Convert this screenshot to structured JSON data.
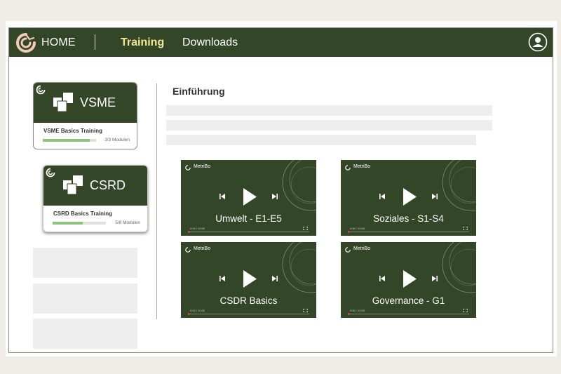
{
  "nav": {
    "home": "HOME",
    "training": "Training",
    "downloads": "Downloads"
  },
  "colors": {
    "brand_green": "#334628",
    "active_nav": "#f1e693",
    "progress_green": "#8cc37d",
    "placeholder_grey": "#eeeeee"
  },
  "courses": [
    {
      "title": "VSME",
      "subtitle": "VSME Basics Training",
      "progress_text": "3/3 Modulen",
      "progress": 0.88,
      "icon": "documents-icon"
    },
    {
      "title": "CSRD",
      "subtitle": "CSRD Basics Training",
      "progress_text": "5/8 Modulen",
      "progress": 0.56,
      "icon": "documents-icon"
    }
  ],
  "section": {
    "title": "Einführung"
  },
  "videos": [
    {
      "brand": "MetriBo",
      "title": "Umwelt - E1-E5",
      "time": "0:00 / 10:00"
    },
    {
      "brand": "MetriBo",
      "title": "Soziales - S1-S4",
      "time": "0:00 / 10:00"
    },
    {
      "brand": "MetriBo",
      "title": "CSDR Basics",
      "time": "0:00 / 10:00"
    },
    {
      "brand": "MetriBo",
      "title": "Governance - G1",
      "time": "0:00 / 10:00"
    }
  ]
}
